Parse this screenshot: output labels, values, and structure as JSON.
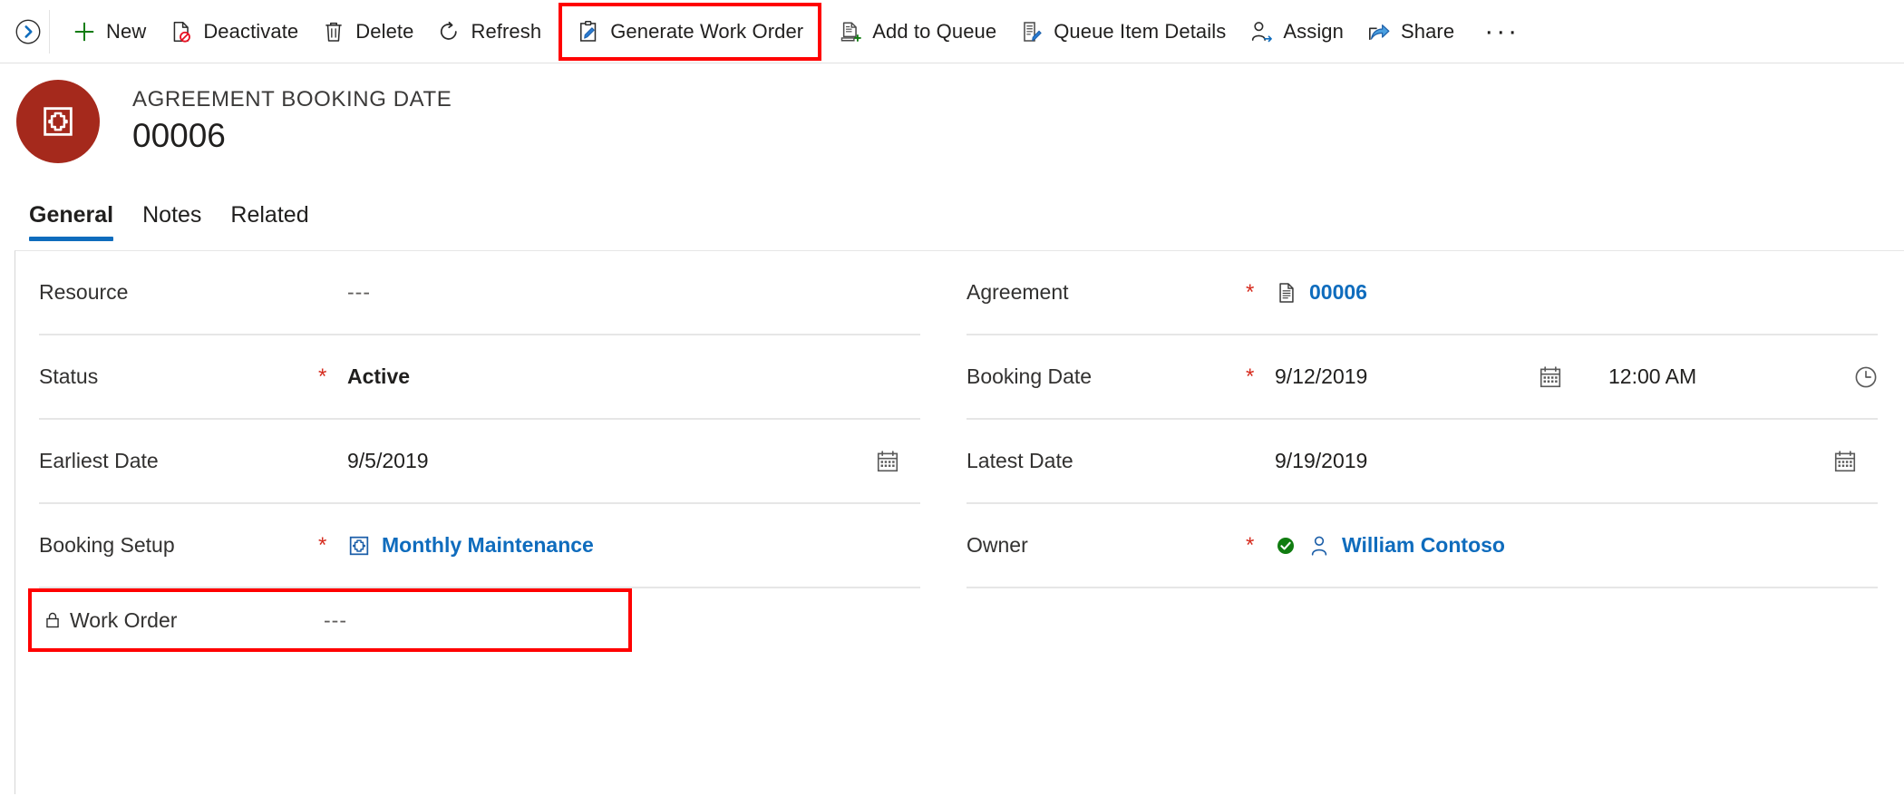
{
  "commandbar": {
    "expand_icon": "chevron-right-circle-icon",
    "items": [
      {
        "id": "new",
        "label": "New",
        "icon": "plus-icon",
        "highlighted": false
      },
      {
        "id": "deactivate",
        "label": "Deactivate",
        "icon": "deactivate-icon",
        "highlighted": false
      },
      {
        "id": "delete",
        "label": "Delete",
        "icon": "trash-icon",
        "highlighted": false
      },
      {
        "id": "refresh",
        "label": "Refresh",
        "icon": "refresh-icon",
        "highlighted": false
      },
      {
        "id": "generate-work-order",
        "label": "Generate Work Order",
        "icon": "clipboard-pencil-icon",
        "highlighted": true
      },
      {
        "id": "add-to-queue",
        "label": "Add to Queue",
        "icon": "document-add-icon",
        "highlighted": false
      },
      {
        "id": "queue-item-details",
        "label": "Queue Item Details",
        "icon": "list-pencil-icon",
        "highlighted": false
      },
      {
        "id": "assign",
        "label": "Assign",
        "icon": "person-arrow-icon",
        "highlighted": false
      },
      {
        "id": "share",
        "label": "Share",
        "icon": "share-icon",
        "highlighted": false
      }
    ],
    "overflow_label": "···"
  },
  "record": {
    "entity_name": "AGREEMENT BOOKING DATE",
    "record_name": "00006",
    "avatar_icon": "agreement-booking-date-icon",
    "avatar_color": "#a5291c"
  },
  "tabs": [
    {
      "id": "general",
      "label": "General",
      "active": true
    },
    {
      "id": "notes",
      "label": "Notes",
      "active": false
    },
    {
      "id": "related",
      "label": "Related",
      "active": false
    }
  ],
  "colors": {
    "accent": "#0f6cbd",
    "required": "#d62c1f",
    "highlight_box": "#ff0000",
    "link": "#0f6cbd",
    "valid_badge": "#107c10"
  },
  "form": {
    "left_column": [
      {
        "id": "resource",
        "label": "Resource",
        "required": false,
        "locked": false,
        "value": "---",
        "value_kind": "empty",
        "trailing_icon": null,
        "highlighted": false
      },
      {
        "id": "status",
        "label": "Status",
        "required": true,
        "locked": false,
        "value": "Active",
        "value_kind": "bold-text",
        "trailing_icon": null,
        "highlighted": false
      },
      {
        "id": "earliest-date",
        "label": "Earliest Date",
        "required": false,
        "locked": false,
        "value": "9/5/2019",
        "value_kind": "date",
        "trailing_icon": "calendar-icon",
        "highlighted": false
      },
      {
        "id": "booking-setup",
        "label": "Booking Setup",
        "required": true,
        "locked": false,
        "value": "Monthly Maintenance",
        "value_kind": "lookup-link",
        "value_icon": "booking-setup-icon",
        "trailing_icon": null,
        "highlighted": false
      },
      {
        "id": "work-order",
        "label": "Work Order",
        "required": false,
        "locked": true,
        "lock_icon": "lock-icon",
        "value": "---",
        "value_kind": "empty",
        "trailing_icon": null,
        "highlighted": true
      }
    ],
    "right_column": [
      {
        "id": "agreement",
        "label": "Agreement",
        "required": true,
        "locked": false,
        "value": "00006",
        "value_kind": "lookup-link",
        "value_icon": "agreement-document-icon",
        "trailing_icon": null,
        "highlighted": false
      },
      {
        "id": "booking-date",
        "label": "Booking Date",
        "required": true,
        "locked": false,
        "value": "9/12/2019",
        "value_kind": "datetime",
        "time_value": "12:00 AM",
        "date_icon": "calendar-icon",
        "time_icon": "clock-icon",
        "highlighted": false
      },
      {
        "id": "latest-date",
        "label": "Latest Date",
        "required": false,
        "locked": false,
        "value": "9/19/2019",
        "value_kind": "date",
        "trailing_icon": "calendar-icon",
        "highlighted": false
      },
      {
        "id": "owner",
        "label": "Owner",
        "required": true,
        "locked": false,
        "value": "William Contoso",
        "value_kind": "owner-link",
        "status_icon": "check-circle-icon",
        "value_icon": "person-icon",
        "trailing_icon": null,
        "highlighted": false
      }
    ]
  }
}
